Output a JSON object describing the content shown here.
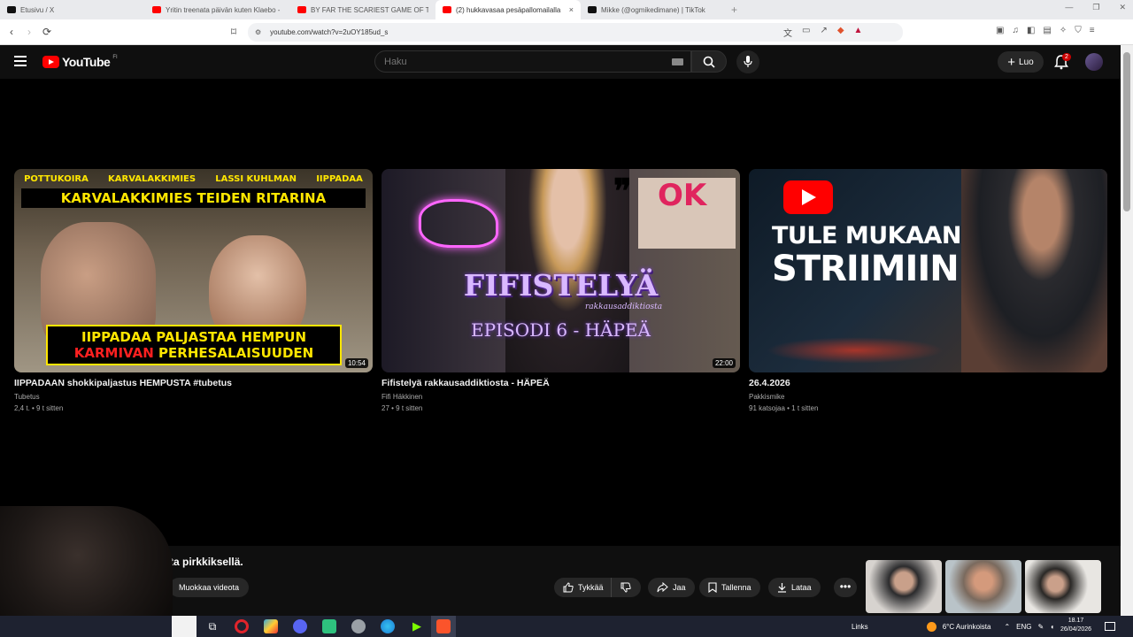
{
  "browser": {
    "tabs": [
      {
        "title": "Etusivu / X",
        "favicon_color": "#111111",
        "active": false
      },
      {
        "title": "Yritin treenata päivän kuten Klaebo -",
        "favicon_color": "#ff0000",
        "active": false
      },
      {
        "title": "BY FAR THE SCARIEST GAME OF THE",
        "favicon_color": "#ff0000",
        "active": false
      },
      {
        "title": "(2) hukkavasaa pesäpallomailalla",
        "favicon_color": "#ff0000",
        "active": true
      },
      {
        "title": "Mikke (@ogmikedimane) | TikTok",
        "favicon_color": "#111111",
        "active": false
      }
    ],
    "close_glyph": "×",
    "new_tab_glyph": "+",
    "url": "youtube.com/watch?v=2uOY185ud_s"
  },
  "youtube": {
    "logo_text": "YouTube",
    "country_code": "FI",
    "search_placeholder": "Haku",
    "create_label": "Luo",
    "notification_count": "2"
  },
  "videos": [
    {
      "title": "IIPPADAAN shokkipaljastus HEMPUSTA #tubetus",
      "channel": "Tubetus",
      "meta": "2,4 t. • 9 t sitten",
      "duration": "10:54",
      "thumb": {
        "top_labels": [
          "POTTUKOIRA",
          "KARVALAKKIMIES",
          "LASSI KUHLMAN",
          "IIPPADAA"
        ],
        "headline": "KARVALAKKIMIES TEIDEN RITARINA",
        "caption_line1": "IIPPADAA PALJASTAA HEMPUN",
        "caption_line2_red": "KARMIVAN",
        "caption_line2_yellow": "PERHESALAISUUDEN"
      }
    },
    {
      "title": "Fifistelyä rakkausaddiktiosta - HÄPEÄ",
      "channel": "Fifi Häkkinen",
      "meta": "27 • 9 t sitten",
      "duration": "22:00",
      "thumb": {
        "title": "FIFISTELYÄ",
        "subtitle": "rakkausaddiktiosta",
        "episode": "EPISODI 6 - HÄPEÄ",
        "sign": "OK"
      }
    },
    {
      "title": "26.4.2026",
      "channel": "Pakkismike",
      "meta": "91 katsojaa • 1 t sitten",
      "duration": "",
      "thumb": {
        "line1": "TULE MUKAAN",
        "line2": "STRIIMIIN"
      }
    }
  ],
  "player": {
    "caption": "llasta pirkkiksellä.",
    "edit_label": "Muokkaa videota",
    "like_label": "Tykkää",
    "share_label": "Jaa",
    "save_label": "Tallenna",
    "download_label": "Lataa",
    "more_glyph": "•••"
  },
  "taskbar": {
    "links_label": "Links",
    "weather": "6°C Aurinkoista",
    "language": "ENG",
    "time": "18.17",
    "date": "26/04/2026"
  },
  "colors": {
    "yt_red": "#ff0000",
    "thumb1_yellow": "#ffe600",
    "thumb2_purple": "#d9b8ff"
  }
}
